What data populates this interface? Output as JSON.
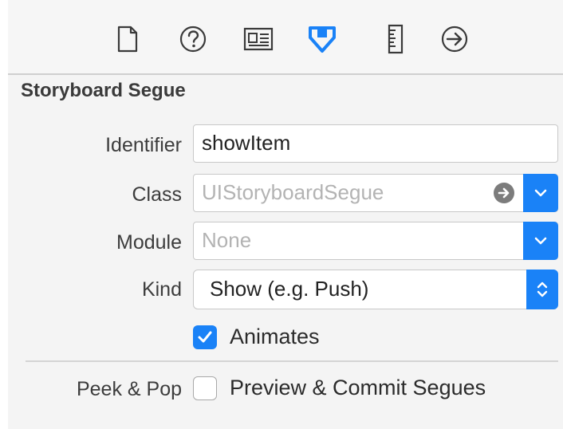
{
  "toolbar": {
    "icons": [
      {
        "name": "file-inspector-icon"
      },
      {
        "name": "quick-help-icon"
      },
      {
        "name": "identity-inspector-icon"
      },
      {
        "name": "attributes-inspector-icon",
        "active": true
      },
      {
        "name": "size-inspector-icon"
      },
      {
        "name": "connections-inspector-icon"
      }
    ],
    "active_color": "#1a82f7",
    "icon_color": "#3a3a3a"
  },
  "section": {
    "title": "Storyboard Segue"
  },
  "fields": {
    "identifier": {
      "label": "Identifier",
      "value": "showItem"
    },
    "class": {
      "label": "Class",
      "placeholder": "UIStoryboardSegue"
    },
    "module": {
      "label": "Module",
      "placeholder": "None"
    },
    "kind": {
      "label": "Kind",
      "value": "Show (e.g. Push)"
    }
  },
  "animates": {
    "label": "Animates",
    "checked": true
  },
  "peek_pop": {
    "label": "Peek & Pop",
    "option_label": "Preview & Commit Segues",
    "checked": false
  },
  "colors": {
    "accent": "#1a82f7"
  }
}
